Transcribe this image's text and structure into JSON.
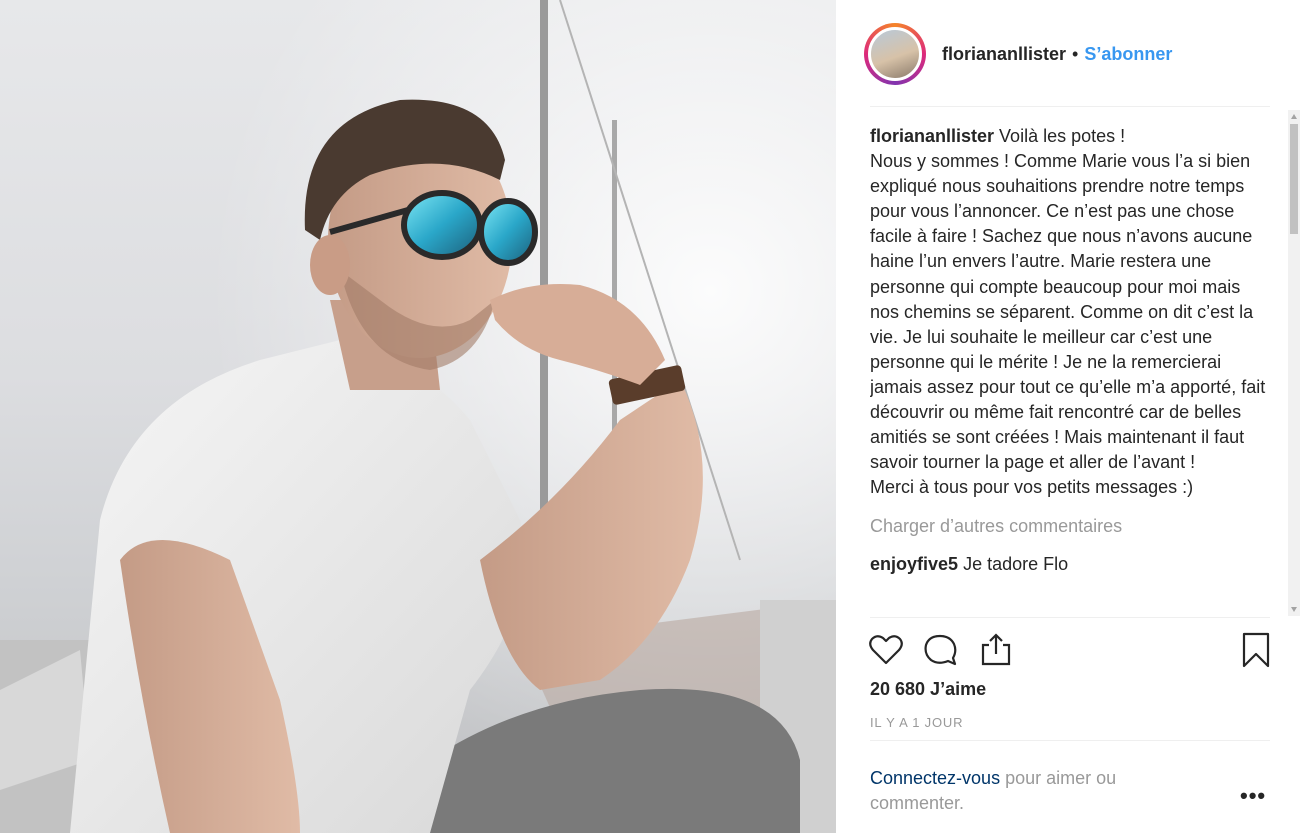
{
  "post": {
    "username": "floriananllister",
    "follow_label": "S’abonner",
    "separator": "•"
  },
  "caption": {
    "username": "floriananllister",
    "text": "Voilà les potes !\nNous y sommes ! Comme Marie vous l’a si bien expliqué nous souhaitions prendre notre temps pour vous l’annoncer. Ce n’est pas une chose facile à faire ! Sachez que nous n’avons aucune haine l’un envers l’autre. Marie restera une personne qui compte beaucoup pour moi mais nos chemins se séparent. Comme on dit c’est la vie. Je lui souhaite le meilleur car c’est une personne qui le mérite ! Je ne la remercierai jamais assez pour tout ce qu’elle m’a apporté, fait découvrir ou même fait rencontré car de belles amitiés se sont créées ! Mais maintenant il faut savoir tourner la page et aller de l’avant !\nMerci à tous pour vos petits messages :)"
  },
  "load_more_label": "Charger d’autres commentaires",
  "comments": [
    {
      "username": "enjoyfive5",
      "text": "Je tadore Flo"
    }
  ],
  "likes_label": "20 680 J’aime",
  "timestamp": "Il y a 1 jour",
  "login": {
    "link": "Connectez-vous",
    "rest": "pour aimer ou commenter."
  },
  "more_label": "•••",
  "icons": [
    "heart-icon",
    "comment-icon",
    "share-icon",
    "bookmark-icon",
    "more-options-icon"
  ],
  "colors": {
    "link_blue": "#3897f0",
    "login_link": "#003569",
    "muted": "#999999",
    "text": "#262626"
  }
}
